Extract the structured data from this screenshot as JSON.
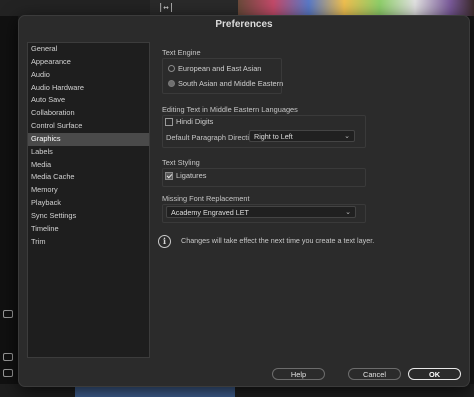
{
  "window": {
    "title": "Preferences"
  },
  "background": {
    "zoom_icon_glyph": "|↔|"
  },
  "sidebar": {
    "items": [
      {
        "label": "General"
      },
      {
        "label": "Appearance"
      },
      {
        "label": "Audio"
      },
      {
        "label": "Audio Hardware"
      },
      {
        "label": "Auto Save"
      },
      {
        "label": "Collaboration"
      },
      {
        "label": "Control Surface"
      },
      {
        "label": "Graphics",
        "selected": true
      },
      {
        "label": "Labels"
      },
      {
        "label": "Media"
      },
      {
        "label": "Media Cache"
      },
      {
        "label": "Memory"
      },
      {
        "label": "Playback"
      },
      {
        "label": "Sync Settings"
      },
      {
        "label": "Timeline"
      },
      {
        "label": "Trim"
      }
    ]
  },
  "graphics": {
    "text_engine": {
      "label": "Text Engine",
      "options": [
        {
          "label": "European and East Asian",
          "checked": false
        },
        {
          "label": "South Asian and Middle Eastern",
          "checked": true
        }
      ]
    },
    "middle_eastern": {
      "label": "Editing Text in Middle Eastern Languages",
      "hindi_digits_label": "Hindi Digits",
      "hindi_digits_checked": false,
      "paragraph_direction_label": "Default Paragraph Direction:",
      "paragraph_direction_value": "Right to Left"
    },
    "text_styling": {
      "label": "Text Styling",
      "ligatures_label": "Ligatures",
      "ligatures_checked": true
    },
    "missing_font": {
      "label": "Missing Font Replacement",
      "value": "Academy Engraved LET"
    },
    "info_icon_glyph": "i",
    "info_message": "Changes will take effect the next time you create a text layer."
  },
  "footer": {
    "help_label": "Help",
    "cancel_label": "Cancel",
    "ok_label": "OK"
  },
  "icons": {
    "chevron": "chevron-down-icon",
    "info": "info-icon"
  }
}
